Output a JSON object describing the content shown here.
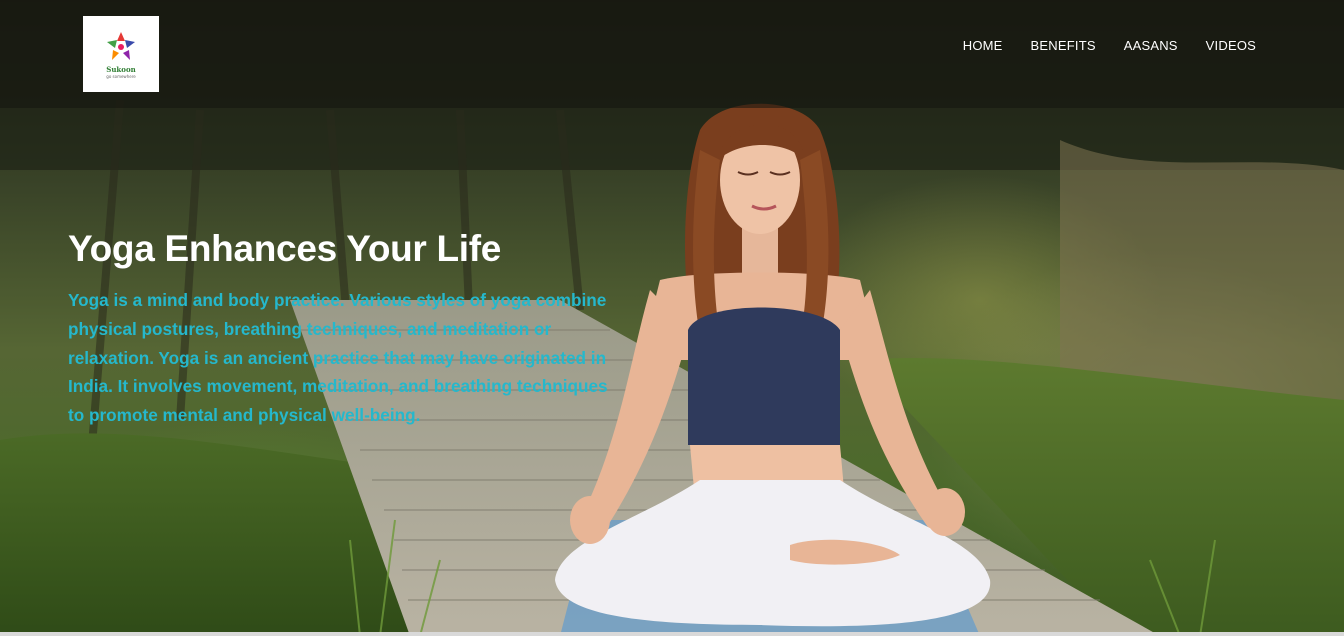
{
  "brand": {
    "logo_text": "Sukoon",
    "logo_subtext": "go somewhere"
  },
  "nav": {
    "items": [
      {
        "label": "HOME"
      },
      {
        "label": "BENEFITS"
      },
      {
        "label": "AASANS"
      },
      {
        "label": "VIDEOS"
      }
    ]
  },
  "hero": {
    "title": "Yoga Enhances Your Life",
    "description": "Yoga is a mind and body practice. Various styles of yoga combine physical postures, breathing techniques, and meditation or relaxation. Yoga is an ancient practice that may have originated in India. It involves movement, meditation, and breathing techniques to promote mental and physical well-being."
  },
  "colors": {
    "accent_text": "#25b8cc",
    "nav_text": "#ffffff",
    "title_text": "#ffffff"
  },
  "icons": {
    "logo": "lotus-logo-icon"
  }
}
